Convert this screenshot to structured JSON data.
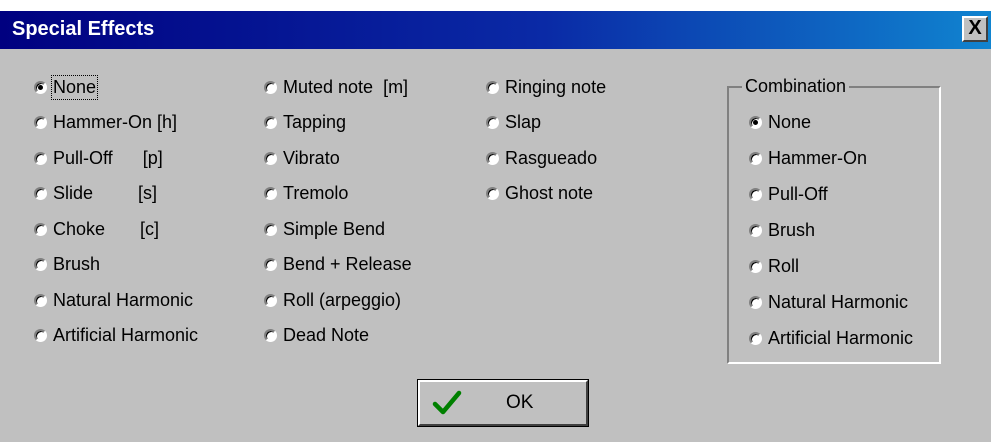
{
  "title": "Special Effects",
  "close_label": "X",
  "columns": [
    {
      "items": [
        {
          "label": "None",
          "checked": true,
          "focus": true
        },
        {
          "label": "Hammer-On [h]"
        },
        {
          "label": "Pull-Off      [p]"
        },
        {
          "label": "Slide         [s]"
        },
        {
          "label": "Choke       [c]"
        },
        {
          "label": "Brush"
        },
        {
          "label": "Natural Harmonic"
        },
        {
          "label": "Artificial Harmonic"
        }
      ]
    },
    {
      "items": [
        {
          "label": "Muted note  [m]"
        },
        {
          "label": "Tapping"
        },
        {
          "label": "Vibrato"
        },
        {
          "label": "Tremolo"
        },
        {
          "label": "Simple Bend"
        },
        {
          "label": "Bend + Release"
        },
        {
          "label": "Roll (arpeggio)"
        },
        {
          "label": "Dead Note"
        }
      ]
    },
    {
      "items": [
        {
          "label": "Ringing note"
        },
        {
          "label": "Slap"
        },
        {
          "label": "Rasgueado"
        },
        {
          "label": "Ghost note"
        }
      ]
    }
  ],
  "combination": {
    "title": "Combination",
    "items": [
      {
        "label": "None",
        "checked": true
      },
      {
        "label": "Hammer-On"
      },
      {
        "label": "Pull-Off"
      },
      {
        "label": "Brush"
      },
      {
        "label": "Roll"
      },
      {
        "label": "Natural Harmonic"
      },
      {
        "label": "Artificial Harmonic"
      }
    ]
  },
  "ok_label": "OK",
  "colors": {
    "title_start": "#000080",
    "title_end": "#1084d0",
    "face": "#c0c0c0",
    "check_icon": "#008000"
  }
}
